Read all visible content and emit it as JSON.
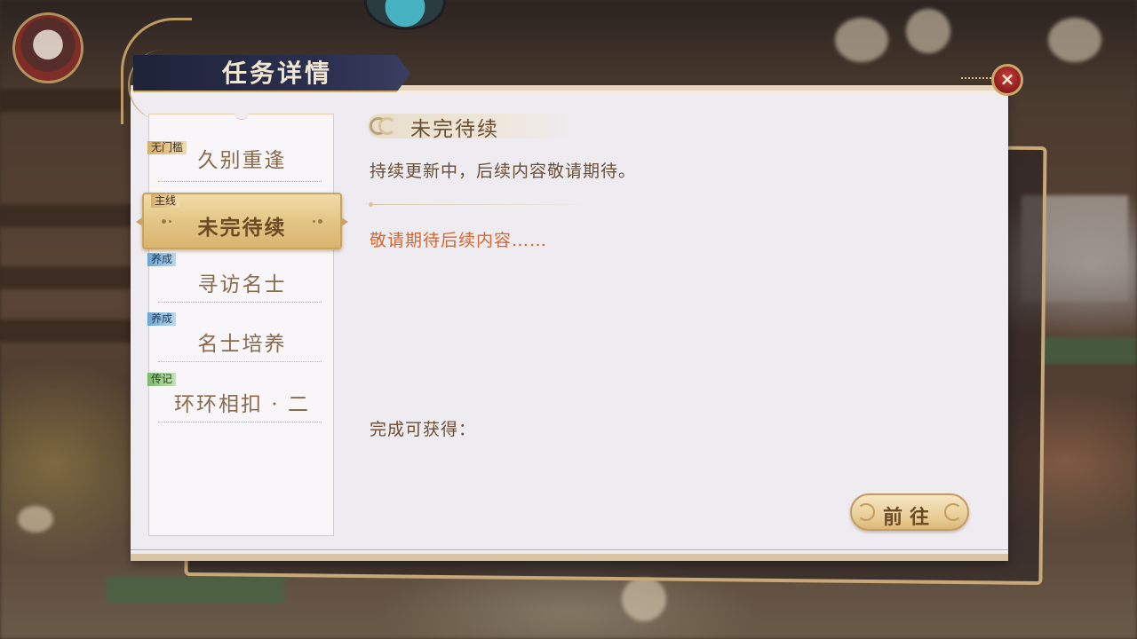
{
  "window": {
    "title": "任务详情",
    "close_icon": "×"
  },
  "quest_list": [
    {
      "tag": "无门槛",
      "tag_color": "#d5b06a",
      "label": "久别重逢",
      "active": false
    },
    {
      "tag": "主线",
      "tag_color": "#d5b06a",
      "label": "未完待续",
      "active": true
    },
    {
      "tag": "养成",
      "tag_color": "#6ea4d2",
      "label": "寻访名士",
      "active": false
    },
    {
      "tag": "养成",
      "tag_color": "#6ea4d2",
      "label": "名士培养",
      "active": false
    },
    {
      "tag": "传记",
      "tag_color": "#7cb86c",
      "label": "环环相扣 · 二",
      "active": false
    }
  ],
  "detail": {
    "title": "未完待续",
    "description": "持续更新中，后续内容敬请期待。",
    "hint": "敬请期待后续内容……",
    "hint_color": "#d8642e",
    "reward_label": "完成可获得：",
    "go_button": "前往"
  }
}
